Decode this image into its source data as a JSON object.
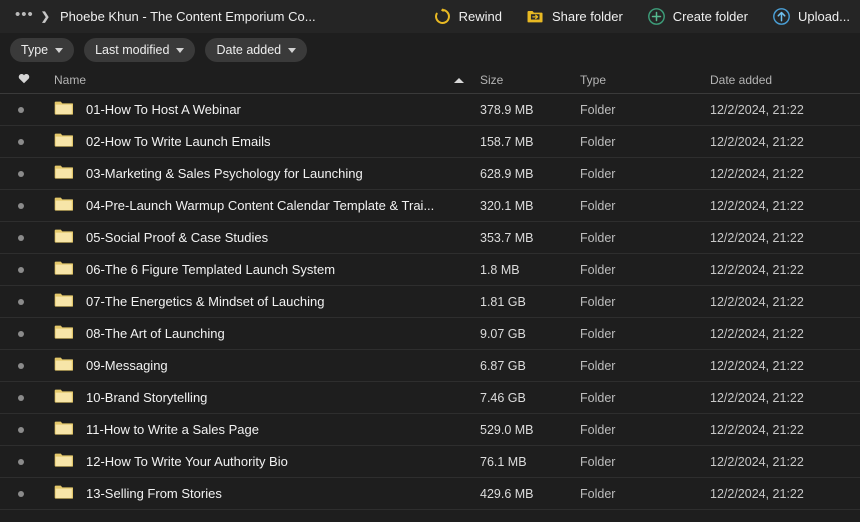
{
  "breadcrumb": {
    "overflow": "•••",
    "separator": "❯",
    "title": "Phoebe Khun - The Content Emporium Co..."
  },
  "toolbar": {
    "actions": [
      {
        "label": "Rewind",
        "icon": "rewind-icon",
        "color": "#e8b923"
      },
      {
        "label": "Share folder",
        "icon": "share-folder-icon",
        "color": "#e8b923"
      },
      {
        "label": "Create folder",
        "icon": "create-folder-icon",
        "color": "#3d9e7a"
      },
      {
        "label": "Upload...",
        "icon": "upload-icon",
        "color": "#4a9fd6"
      }
    ]
  },
  "filters": [
    {
      "label": "Type"
    },
    {
      "label": "Last modified"
    },
    {
      "label": "Date added"
    }
  ],
  "table": {
    "headers": {
      "favorite": "heart-icon",
      "name": "Name",
      "sort": "ascending",
      "size": "Size",
      "type": "Type",
      "date_added": "Date added"
    },
    "rows": [
      {
        "name": "01-How To Host A Webinar",
        "size": "378.9 MB",
        "type": "Folder",
        "date": "12/2/2024, 21:22"
      },
      {
        "name": "02-How To Write Launch Emails",
        "size": "158.7 MB",
        "type": "Folder",
        "date": "12/2/2024, 21:22"
      },
      {
        "name": "03-Marketing & Sales Psychology for Launching",
        "size": "628.9 MB",
        "type": "Folder",
        "date": "12/2/2024, 21:22"
      },
      {
        "name": "04-Pre-Launch Warmup Content Calendar Template & Trai...",
        "size": "320.1 MB",
        "type": "Folder",
        "date": "12/2/2024, 21:22"
      },
      {
        "name": "05-Social Proof & Case Studies",
        "size": "353.7 MB",
        "type": "Folder",
        "date": "12/2/2024, 21:22"
      },
      {
        "name": "06-The 6 Figure Templated Launch System",
        "size": "1.8 MB",
        "type": "Folder",
        "date": "12/2/2024, 21:22"
      },
      {
        "name": "07-The Energetics & Mindset of Lauching",
        "size": "1.81 GB",
        "type": "Folder",
        "date": "12/2/2024, 21:22"
      },
      {
        "name": "08-The Art of Launching",
        "size": "9.07 GB",
        "type": "Folder",
        "date": "12/2/2024, 21:22"
      },
      {
        "name": "09-Messaging",
        "size": "6.87 GB",
        "type": "Folder",
        "date": "12/2/2024, 21:22"
      },
      {
        "name": "10-Brand Storytelling",
        "size": "7.46 GB",
        "type": "Folder",
        "date": "12/2/2024, 21:22"
      },
      {
        "name": "11-How to Write a Sales Page",
        "size": "529.0 MB",
        "type": "Folder",
        "date": "12/2/2024, 21:22"
      },
      {
        "name": "12-How To Write Your Authority Bio",
        "size": "76.1 MB",
        "type": "Folder",
        "date": "12/2/2024, 21:22"
      },
      {
        "name": "13-Selling From Stories",
        "size": "429.6 MB",
        "type": "Folder",
        "date": "12/2/2024, 21:22"
      }
    ]
  },
  "colors": {
    "background": "#1e1e1e",
    "topbar": "#252525",
    "folder": "#f2d98c",
    "rewind": "#e8b923",
    "create": "#3d9e7a",
    "upload": "#4a9fd6"
  }
}
